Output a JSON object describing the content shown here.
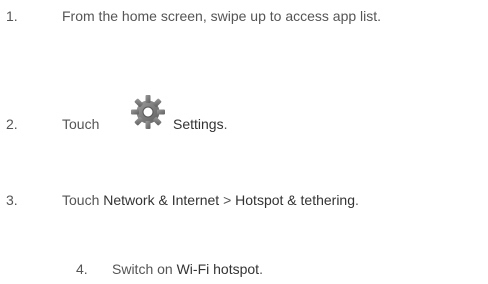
{
  "steps": [
    {
      "number": "1.",
      "text": "From the home screen, swipe up to access app list."
    },
    {
      "number": "2.",
      "prefix": "Touch",
      "icon": "settings-gear-icon",
      "target": "Settings",
      "suffix": "."
    },
    {
      "number": "3.",
      "prefix": "Touch",
      "target1": "Network & Internet",
      "separator": ">",
      "target2": "Hotspot & tethering",
      "suffix": "."
    },
    {
      "number": "4.",
      "prefix": "Switch on",
      "target": "Wi-Fi hotspot",
      "suffix": "."
    }
  ]
}
